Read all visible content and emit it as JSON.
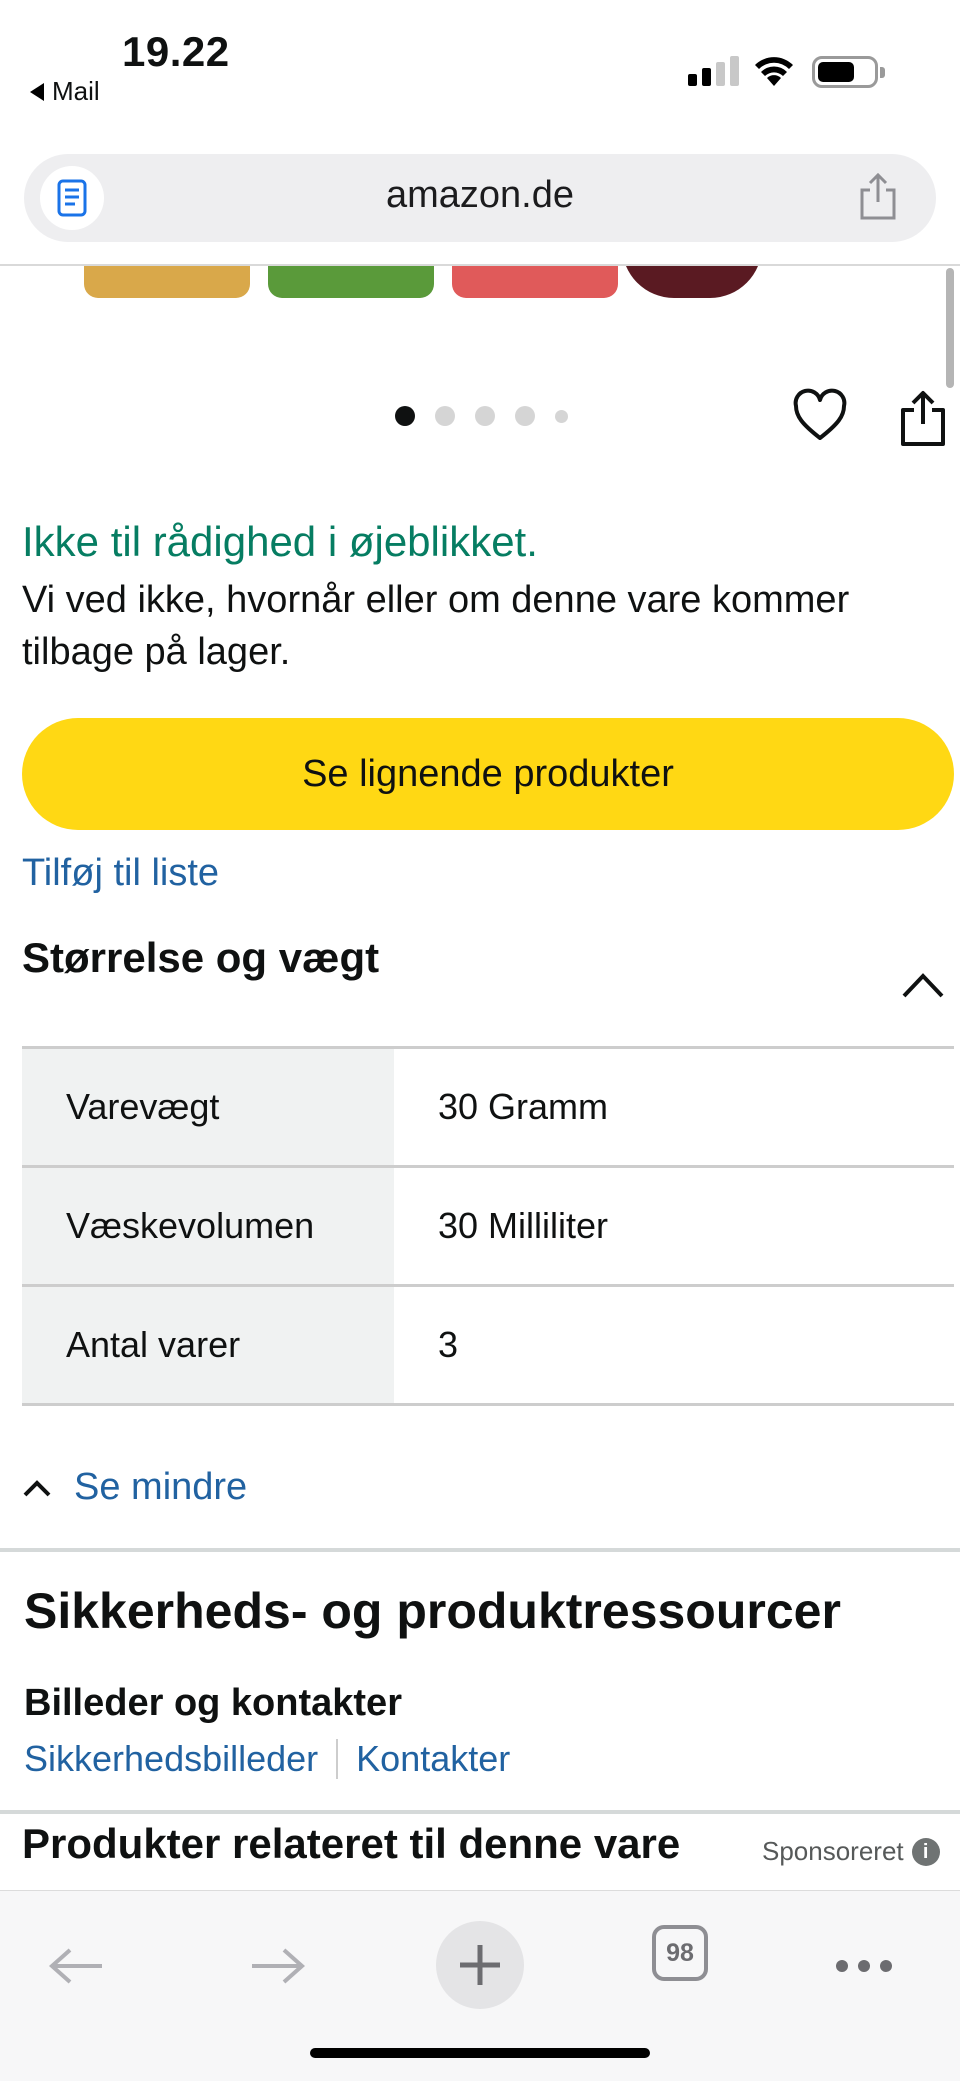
{
  "status_bar": {
    "time": "19.22",
    "back_app": "Mail"
  },
  "browser": {
    "url": "amazon.de",
    "tabs_count": "98",
    "reader_icon": "reader-view-icon",
    "share_icon": "share-icon"
  },
  "product": {
    "carousel": {
      "total_images": 5,
      "active_index": 0
    },
    "availability_title": "Ikke til rådighed i øjeblikket.",
    "availability_desc": "Vi ved ikke, hvornår eller om denne vare kommer tilbage på lager.",
    "cta_label": "Se lignende produkter",
    "add_to_list": "Tilføj til liste"
  },
  "size_weight": {
    "title": "Størrelse og vægt",
    "rows": [
      {
        "key": "Varevægt",
        "value": "30 Gramm"
      },
      {
        "key": "Væskevolumen",
        "value": "30 Milliliter"
      },
      {
        "key": "Antal varer",
        "value": "3"
      }
    ],
    "see_less": "Se mindre"
  },
  "safety": {
    "title": "Sikkerheds- og produktressourcer",
    "subtitle": "Billeder og kontakter",
    "links": [
      "Sikkerhedsbilleder",
      "Kontakter"
    ]
  },
  "related": {
    "title": "Produkter relateret til denne vare",
    "sponsored": "Sponsoreret"
  },
  "colors": {
    "accent_green": "#067d62",
    "link_blue": "#2162a1",
    "cta_yellow": "#ffd814"
  }
}
